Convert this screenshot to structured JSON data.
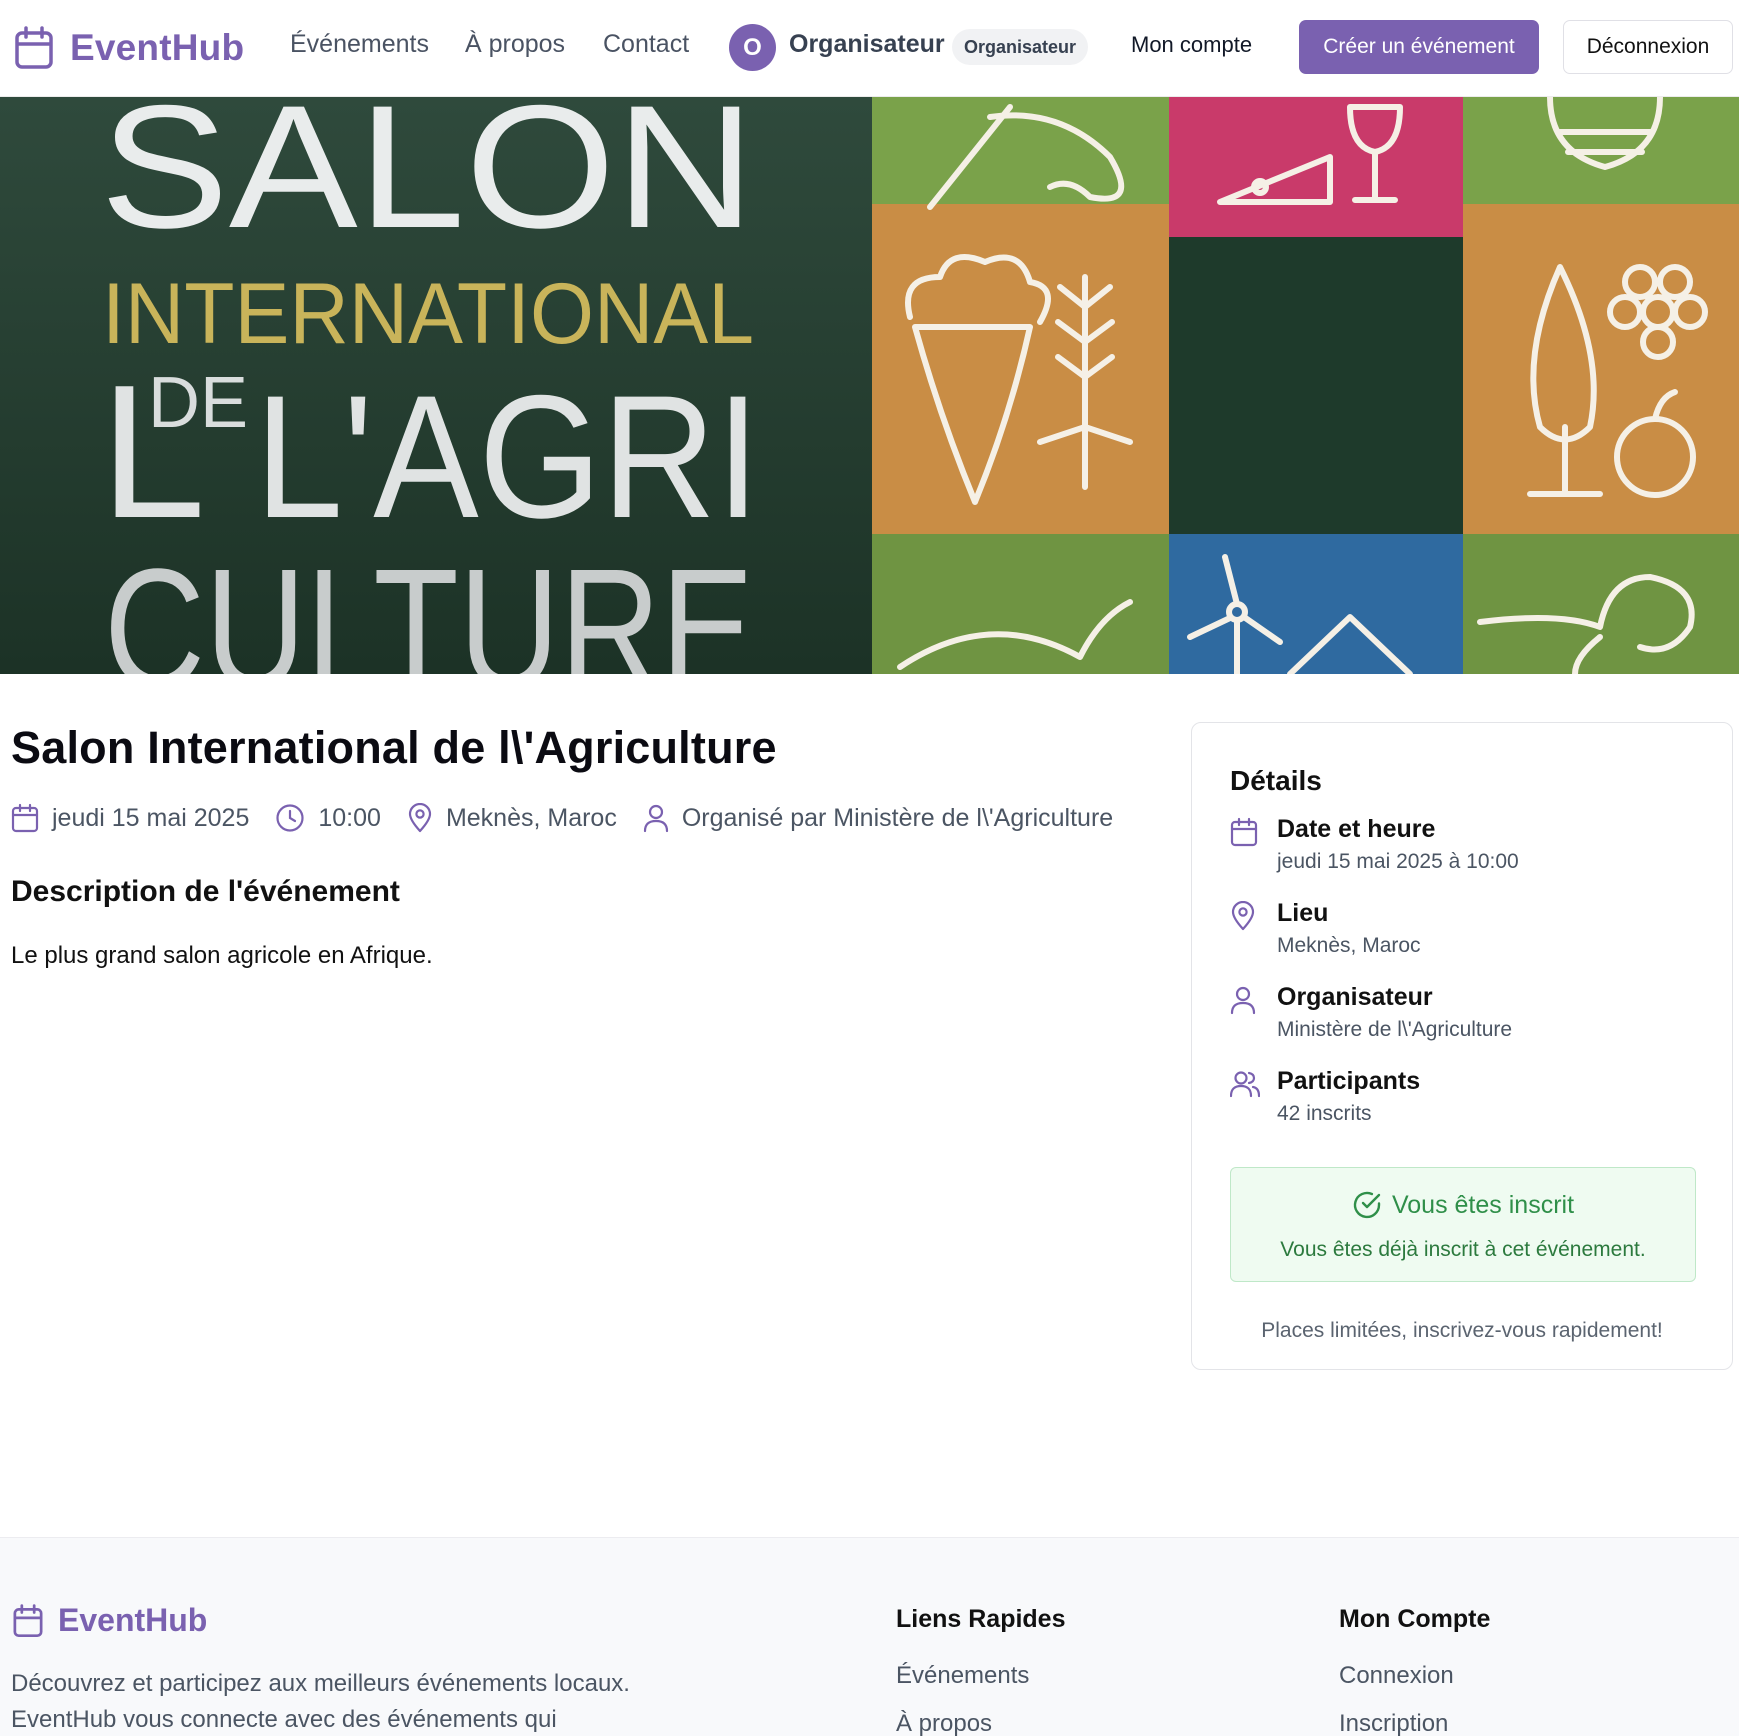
{
  "brand": {
    "name": "EventHub",
    "accent_color": "#7a61b0"
  },
  "nav": {
    "links": [
      "Événements",
      "À propos",
      "Contact"
    ],
    "user": {
      "initial": "O",
      "name": "Organisateur",
      "role_badge": "Organisateur"
    },
    "account_link": "Mon compte",
    "create_button": "Créer un événement",
    "logout_button": "Déconnexion"
  },
  "hero": {
    "banner_lines": [
      "SALON",
      "INTERNATIONAL",
      "DE",
      "L'AGRI",
      "CULTURE"
    ],
    "tile_icons": [
      "rooster-icon",
      "cheese-wine-icon",
      "honey-pot-icon",
      "carrot-wheat-icon",
      "tree-grapes-apple-icon",
      "fish-icon",
      "wind-turbine-house-icon",
      "ram-icon"
    ]
  },
  "event": {
    "title": "Salon International de l\\'Agriculture",
    "date": "jeudi 15 mai 2025",
    "time": "10:00",
    "location": "Meknès, Maroc",
    "organizer_line": "Organisé par Ministère de l\\'Agriculture",
    "description_heading": "Description de l'événement",
    "description": "Le plus grand salon agricole en Afrique."
  },
  "details": {
    "title": "Détails",
    "rows": [
      {
        "label": "Date et heure",
        "value": "jeudi 15 mai 2025 à 10:00",
        "icon": "calendar-icon"
      },
      {
        "label": "Lieu",
        "value": "Meknès, Maroc",
        "icon": "map-pin-icon"
      },
      {
        "label": "Organisateur",
        "value": "Ministère de l\\'Agriculture",
        "icon": "user-icon"
      },
      {
        "label": "Participants",
        "value": "42 inscrits",
        "icon": "users-icon"
      }
    ],
    "registration": {
      "title": "Vous êtes inscrit",
      "text": "Vous êtes déjà inscrit à cet événement.",
      "color": "#2f8f49"
    },
    "note": "Places limitées, inscrivez-vous rapidement!"
  },
  "footer": {
    "brand": "EventHub",
    "description": "Découvrez et participez aux meilleurs événements locaux. EventHub vous connecte avec des événements qui",
    "columns": [
      {
        "title": "Liens Rapides",
        "links": [
          "Événements",
          "À propos"
        ]
      },
      {
        "title": "Mon Compte",
        "links": [
          "Connexion",
          "Inscription"
        ]
      }
    ]
  }
}
